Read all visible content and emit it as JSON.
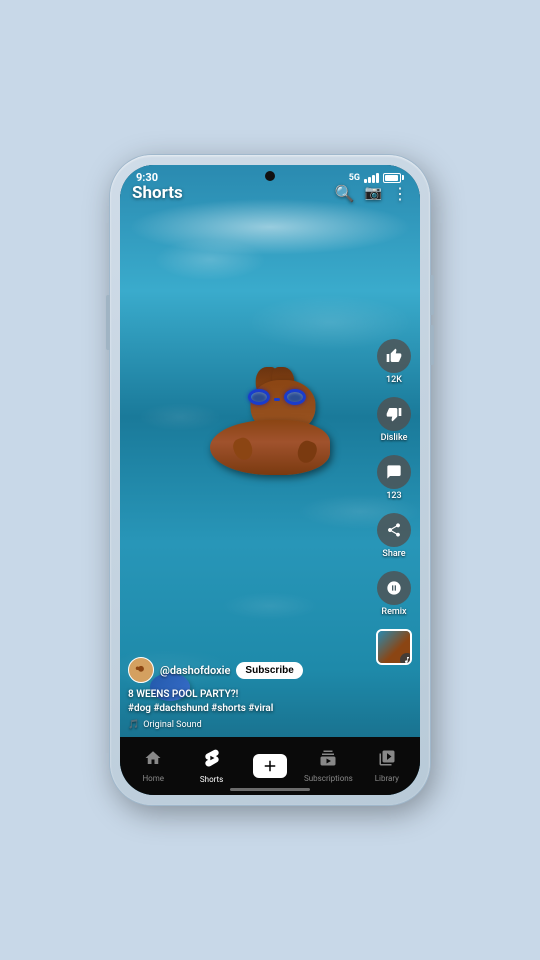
{
  "status_bar": {
    "time": "9:30",
    "network": "5G"
  },
  "top_bar": {
    "title": "Shorts",
    "search_label": "search",
    "camera_label": "camera",
    "more_label": "more"
  },
  "video": {
    "channel_handle": "@dashofdoxie",
    "subscribe_label": "Subscribe",
    "description_line1": "8 WEENS POOL PARTY?!",
    "description_line2": "#dog #dachshund #shorts #viral",
    "music_label": "Original Sound"
  },
  "side_actions": {
    "like_count": "12K",
    "like_label": "Like",
    "dislike_label": "Dislike",
    "comment_count": "123",
    "comment_label": "Comments",
    "share_label": "Share",
    "remix_label": "Remix"
  },
  "bottom_nav": {
    "items": [
      {
        "label": "Home",
        "icon": "home",
        "active": false
      },
      {
        "label": "Shorts",
        "icon": "shorts",
        "active": true
      },
      {
        "label": "",
        "icon": "add",
        "active": false
      },
      {
        "label": "Subscriptions",
        "icon": "subscriptions",
        "active": false
      },
      {
        "label": "Library",
        "icon": "library",
        "active": false
      }
    ]
  }
}
